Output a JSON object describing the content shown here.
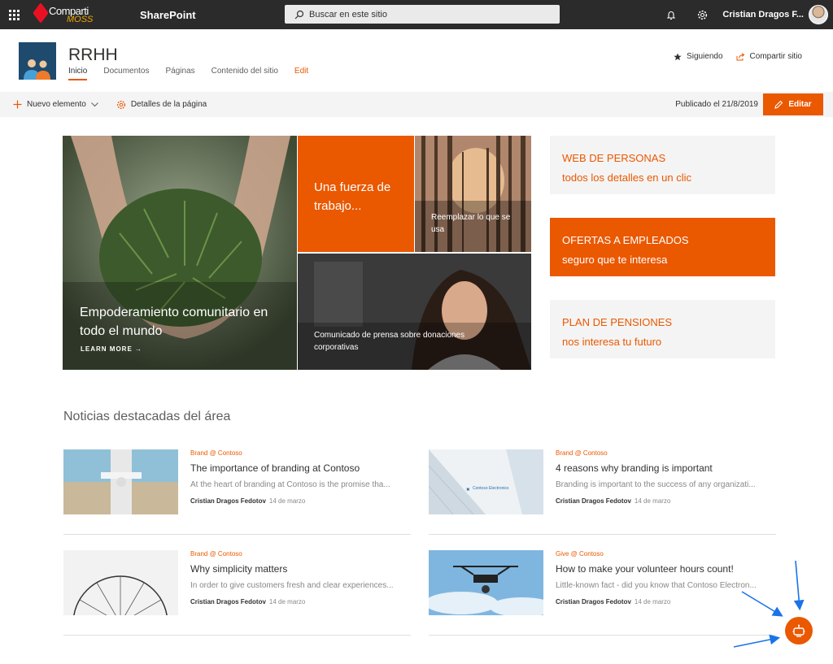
{
  "suitebar": {
    "brand_top": "Comparti",
    "brand_bottom": "MOSS",
    "app_name": "SharePoint",
    "search_placeholder": "Buscar en este sitio",
    "user_name": "Cristian Dragos F..."
  },
  "site": {
    "title": "RRHH",
    "nav": [
      "Inicio",
      "Documentos",
      "Páginas",
      "Contenido del sitio",
      "Edit"
    ],
    "following": "Siguiendo",
    "share": "Compartir sitio"
  },
  "commandbar": {
    "new_item": "Nuevo elemento",
    "page_details": "Detalles de la página",
    "published": "Publicado el 21/8/2019",
    "edit": "Editar"
  },
  "hero": {
    "main_title": "Empoderamiento comunitario en todo el mundo",
    "learn_more": "LEARN MORE",
    "orange_title": "Una fuerza de trabajo...",
    "forest_title": "Reemplazar lo que se usa",
    "press_title": "Comunicado de prensa sobre donaciones corporativas"
  },
  "quicklinks": [
    {
      "title": "WEB DE PERSONAS",
      "subtitle": "todos los detalles en un clic",
      "style": "grey"
    },
    {
      "title": "OFERTAS A EMPLEADOS",
      "subtitle": "seguro que te interesa",
      "style": "orange"
    },
    {
      "title": "PLAN DE PENSIONES",
      "subtitle": "nos interesa tu futuro",
      "style": "grey"
    }
  ],
  "news": {
    "section_title": "Noticias destacadas del área",
    "items": [
      {
        "category": "Brand @ Contoso",
        "title": "The importance of branding at Contoso",
        "description": "At the heart of branding at Contoso is the promise tha...",
        "author": "Cristian Dragos Fedotov",
        "date": "14 de marzo"
      },
      {
        "category": "Brand @ Contoso",
        "title": "4 reasons why branding is important",
        "description": "Branding is important to the success of any organizati...",
        "author": "Cristian Dragos Fedotov",
        "date": "14 de marzo",
        "thumb_label": "Contoso Electronics"
      },
      {
        "category": "Brand @ Contoso",
        "title": "Why simplicity matters",
        "description": "In order to give customers fresh and clear experiences...",
        "author": "Cristian Dragos Fedotov",
        "date": "14 de marzo"
      },
      {
        "category": "Give @ Contoso",
        "title": "How to make your volunteer hours count!",
        "description": "Little-known fact - did you know that Contoso Electron...",
        "author": "Cristian Dragos Fedotov",
        "date": "14 de marzo"
      }
    ]
  },
  "colors": {
    "accent": "#ea5800",
    "suitebar": "#2b2b2b",
    "annotation_arrow": "#1a73e8"
  }
}
